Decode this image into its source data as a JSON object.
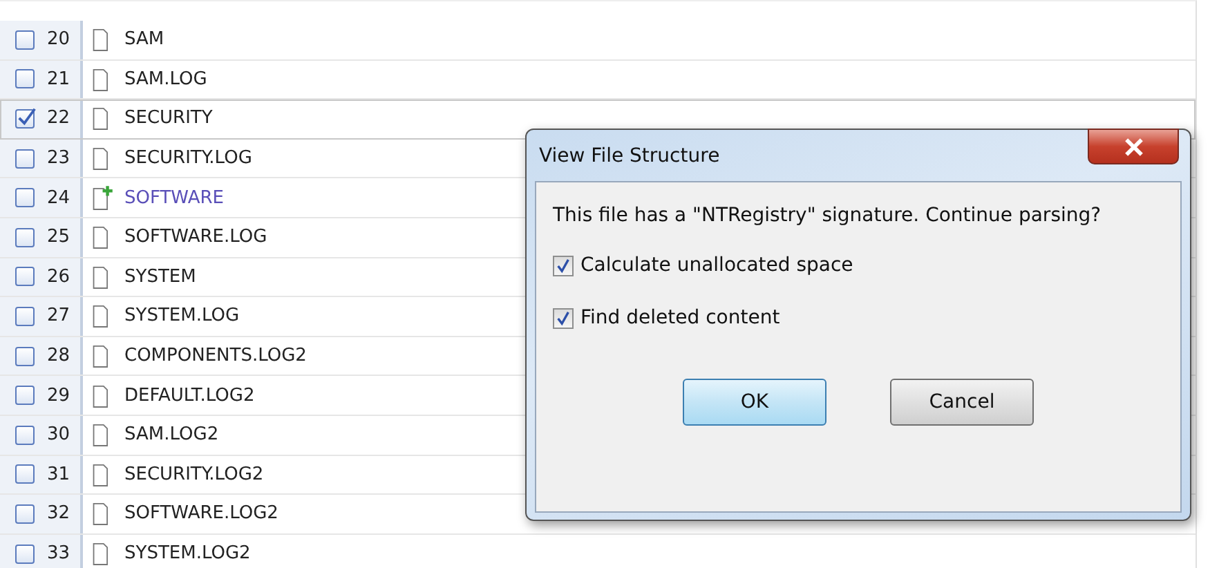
{
  "file_list": {
    "rows": [
      {
        "number": "20",
        "name": "SAM",
        "checked": false,
        "selected": false,
        "added": false
      },
      {
        "number": "21",
        "name": "SAM.LOG",
        "checked": false,
        "selected": false,
        "added": false
      },
      {
        "number": "22",
        "name": "SECURITY",
        "checked": true,
        "selected": true,
        "added": false
      },
      {
        "number": "23",
        "name": "SECURITY.LOG",
        "checked": false,
        "selected": false,
        "added": false
      },
      {
        "number": "24",
        "name": "SOFTWARE",
        "checked": false,
        "selected": false,
        "added": true
      },
      {
        "number": "25",
        "name": "SOFTWARE.LOG",
        "checked": false,
        "selected": false,
        "added": false
      },
      {
        "number": "26",
        "name": "SYSTEM",
        "checked": false,
        "selected": false,
        "added": false
      },
      {
        "number": "27",
        "name": "SYSTEM.LOG",
        "checked": false,
        "selected": false,
        "added": false
      },
      {
        "number": "28",
        "name": "COMPONENTS.LOG2",
        "checked": false,
        "selected": false,
        "added": false
      },
      {
        "number": "29",
        "name": "DEFAULT.LOG2",
        "checked": false,
        "selected": false,
        "added": false
      },
      {
        "number": "30",
        "name": "SAM.LOG2",
        "checked": false,
        "selected": false,
        "added": false
      },
      {
        "number": "31",
        "name": "SECURITY.LOG2",
        "checked": false,
        "selected": false,
        "added": false
      },
      {
        "number": "32",
        "name": "SOFTWARE.LOG2",
        "checked": false,
        "selected": false,
        "added": false
      },
      {
        "number": "33",
        "name": "SYSTEM.LOG2",
        "checked": false,
        "selected": false,
        "added": false
      }
    ]
  },
  "dialog": {
    "title": "View File Structure",
    "message": "This file has a \"NTRegistry\" signature.  Continue parsing?",
    "options": [
      {
        "label": "Calculate unallocated space",
        "checked": true
      },
      {
        "label": "Find deleted content",
        "checked": true
      }
    ],
    "buttons": [
      {
        "label": "OK",
        "default": true
      },
      {
        "label": "Cancel",
        "default": false
      }
    ]
  }
}
